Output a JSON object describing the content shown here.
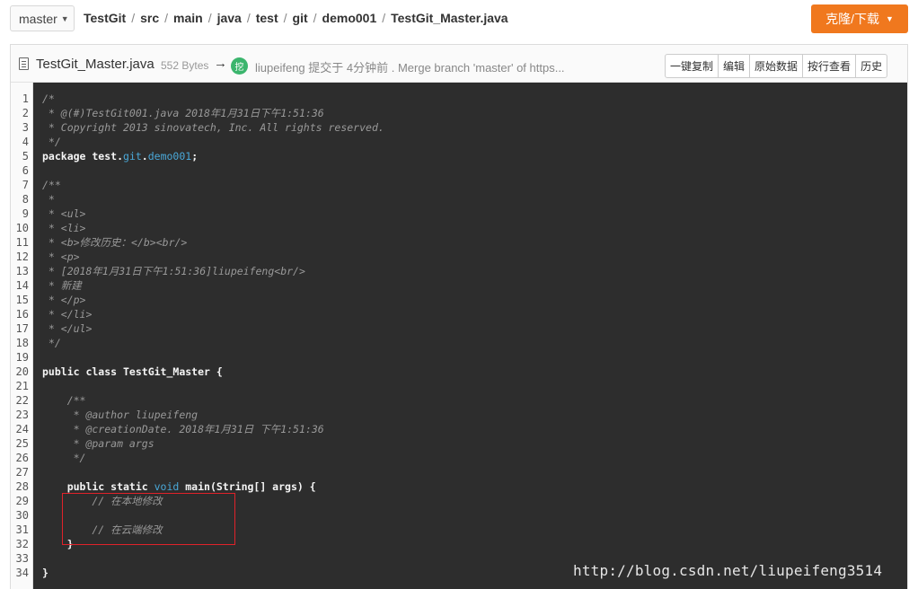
{
  "branch": {
    "label": "master"
  },
  "breadcrumb": [
    "TestGit",
    "src",
    "main",
    "java",
    "test",
    "git",
    "demo001",
    "TestGit_Master.java"
  ],
  "clone_button": "克隆/下载",
  "file": {
    "name": "TestGit_Master.java",
    "size": "552 Bytes",
    "arrow": "→",
    "author_avatar": "挖",
    "commit_text": "liupeifeng 提交于 4分钟前 . Merge branch 'master' of https..."
  },
  "actions": [
    "一键复制",
    "编辑",
    "原始数据",
    "按行查看",
    "历史"
  ],
  "code": {
    "line_numbers": [
      "1",
      "2",
      "3",
      "4",
      "5",
      "6",
      "7",
      "8",
      "9",
      "10",
      "11",
      "12",
      "13",
      "14",
      "15",
      "16",
      "17",
      "18",
      "19",
      "20",
      "21",
      "22",
      "23",
      "24",
      "25",
      "26",
      "27",
      "28",
      "29",
      "30",
      "31",
      "32",
      "33",
      "34"
    ],
    "lines": [
      "/*",
      " * @(#)TestGit001.java 2018年1月31日下午1:51:36",
      " * Copyright 2013 sinovatech, Inc. All rights reserved.",
      " */",
      "package test.git.demo001;",
      "",
      "/**",
      " *",
      " * <ul>",
      " * <li>",
      " * <b>修改历史：</b><br/>",
      " * <p>",
      " * [2018年1月31日下午1:51:36]liupeifeng<br/>",
      " * 新建",
      " * </p>",
      " * </li>",
      " * </ul>",
      " */",
      "",
      "public class TestGit_Master {",
      "",
      "    /**",
      "     * @author liupeifeng",
      "     * @creationDate. 2018年1月31日 下午1:51:36",
      "     * @param args",
      "     */",
      "",
      "    public static void main(String[] args) {",
      "        // 在本地修改",
      "",
      "        // 在云端修改",
      "    }",
      "",
      "}"
    ]
  },
  "watermark": "http://blog.csdn.net/liupeifeng3514"
}
